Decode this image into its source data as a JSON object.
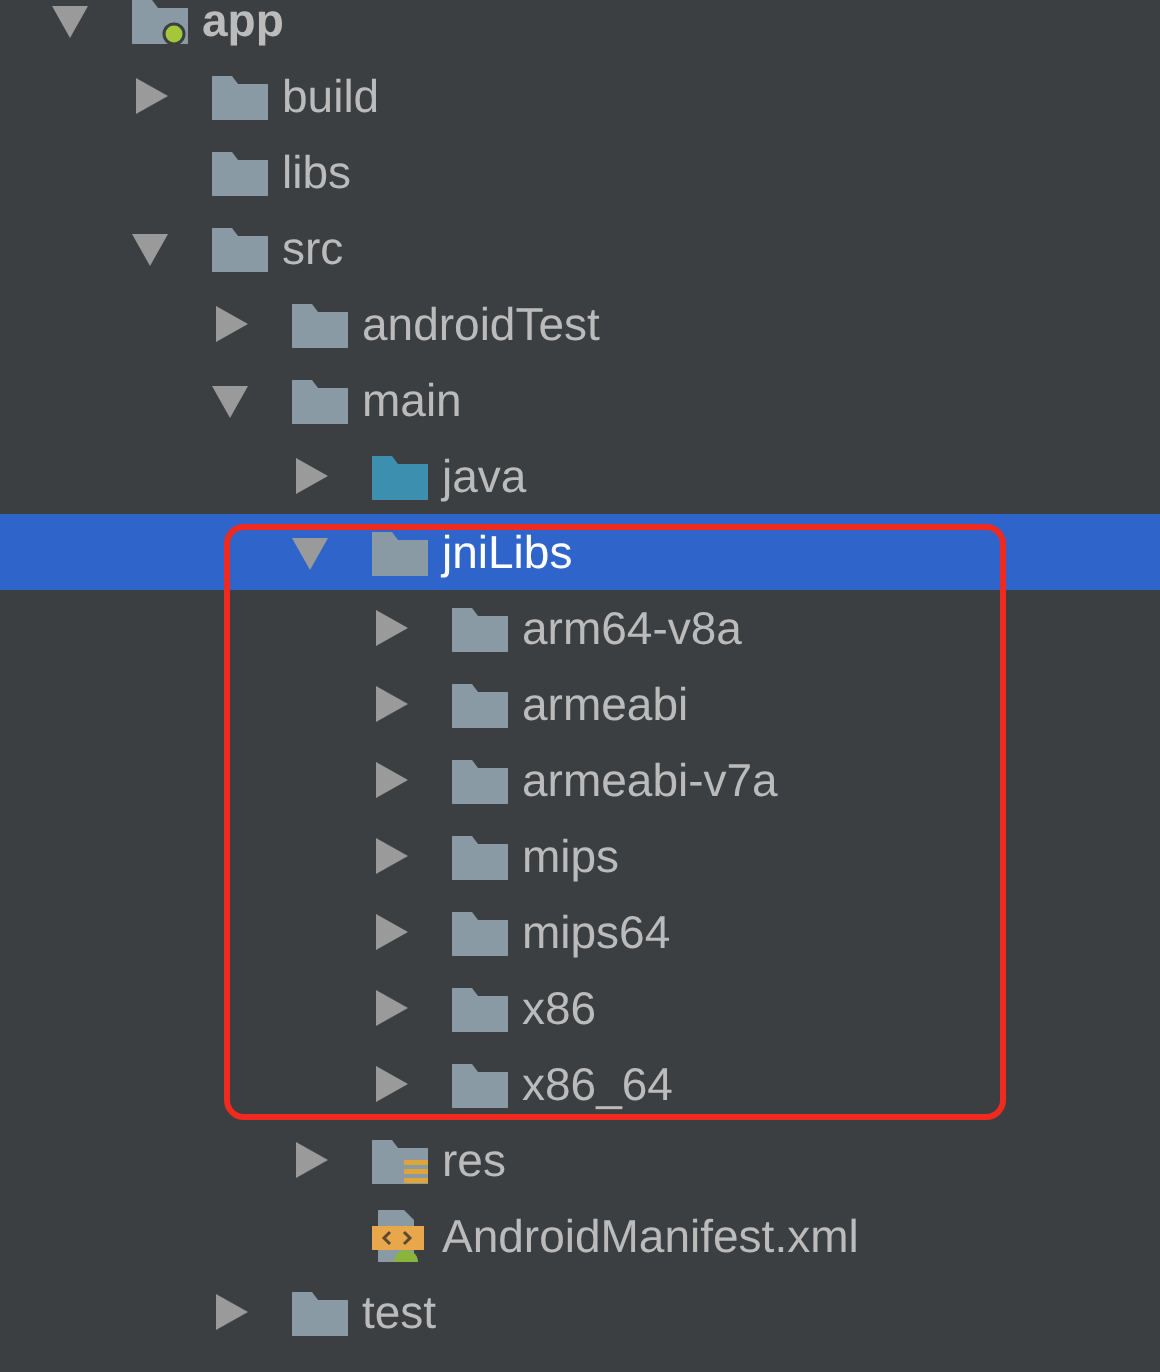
{
  "tree": [
    {
      "name": "app",
      "kind": "module",
      "expanded": true,
      "selected": false,
      "children": [
        {
          "name": "build",
          "kind": "folder",
          "expanded": false,
          "selected": false
        },
        {
          "name": "libs",
          "kind": "folder",
          "selected": false
        },
        {
          "name": "src",
          "kind": "folder",
          "expanded": true,
          "selected": false,
          "children": [
            {
              "name": "androidTest",
              "kind": "folder",
              "expanded": false,
              "selected": false
            },
            {
              "name": "main",
              "kind": "folder",
              "expanded": true,
              "selected": false,
              "children": [
                {
                  "name": "java",
                  "kind": "source",
                  "expanded": false,
                  "selected": false
                },
                {
                  "name": "jniLibs",
                  "kind": "folder",
                  "expanded": true,
                  "selected": true,
                  "children": [
                    {
                      "name": "arm64-v8a",
                      "kind": "folder",
                      "expanded": false,
                      "selected": false
                    },
                    {
                      "name": "armeabi",
                      "kind": "folder",
                      "expanded": false,
                      "selected": false
                    },
                    {
                      "name": "armeabi-v7a",
                      "kind": "folder",
                      "expanded": false,
                      "selected": false
                    },
                    {
                      "name": "mips",
                      "kind": "folder",
                      "expanded": false,
                      "selected": false
                    },
                    {
                      "name": "mips64",
                      "kind": "folder",
                      "expanded": false,
                      "selected": false
                    },
                    {
                      "name": "x86",
                      "kind": "folder",
                      "expanded": false,
                      "selected": false
                    },
                    {
                      "name": "x86_64",
                      "kind": "folder",
                      "expanded": false,
                      "selected": false
                    }
                  ]
                },
                {
                  "name": "res",
                  "kind": "resources",
                  "expanded": false,
                  "selected": false
                },
                {
                  "name": "AndroidManifest.xml",
                  "kind": "manifest",
                  "selected": false
                }
              ]
            },
            {
              "name": "test",
              "kind": "folder",
              "expanded": false,
              "selected": false
            }
          ]
        }
      ]
    }
  ]
}
